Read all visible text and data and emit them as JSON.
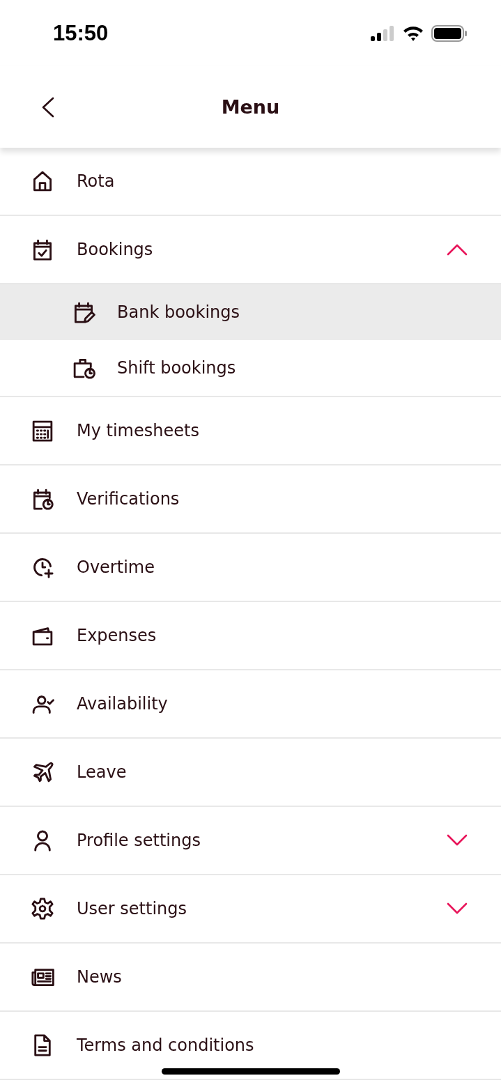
{
  "status_bar": {
    "time": "15:50"
  },
  "header": {
    "title": "Menu"
  },
  "menu": [
    {
      "label": "Rota"
    },
    {
      "label": "Bookings",
      "expanded": true,
      "children": [
        {
          "label": "Bank bookings",
          "selected": true
        },
        {
          "label": "Shift bookings",
          "selected": false
        }
      ]
    },
    {
      "label": "My timesheets"
    },
    {
      "label": "Verifications"
    },
    {
      "label": "Overtime"
    },
    {
      "label": "Expenses"
    },
    {
      "label": "Availability"
    },
    {
      "label": "Leave"
    },
    {
      "label": "Profile settings",
      "expanded": false
    },
    {
      "label": "User settings",
      "expanded": false
    },
    {
      "label": "News"
    },
    {
      "label": "Terms and conditions"
    }
  ]
}
